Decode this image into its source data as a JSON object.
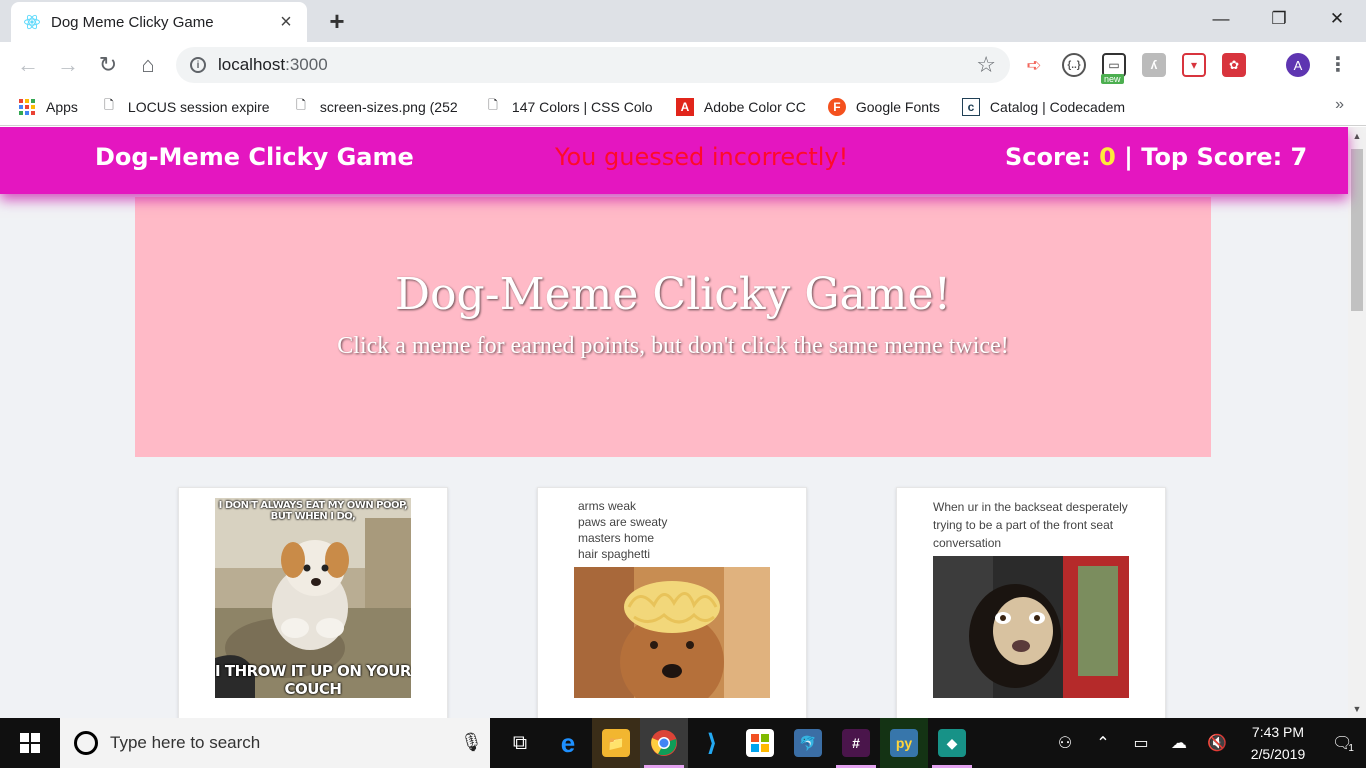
{
  "browser": {
    "tab_title": "Dog Meme Clicky Game",
    "url_host": "localhost",
    "url_port": ":3000",
    "ext_badge": "new",
    "profile_initial": "A",
    "bookmarks": [
      {
        "label": "Apps",
        "icon": "apps-grid-icon"
      },
      {
        "label": "LOCUS session expire",
        "icon": "page-icon"
      },
      {
        "label": "screen-sizes.png (252",
        "icon": "page-icon"
      },
      {
        "label": "147 Colors | CSS Colo",
        "icon": "page-icon"
      },
      {
        "label": "Adobe Color CC",
        "icon": "adobe-icon"
      },
      {
        "label": "Google Fonts",
        "icon": "google-fonts-icon"
      },
      {
        "label": "Catalog | Codecadem",
        "icon": "codecademy-icon"
      }
    ]
  },
  "app": {
    "brand": "Dog-Meme Clicky Game",
    "message": "You guessed incorrectly!",
    "score_label": "Score: ",
    "score_value": "0",
    "top_score_text": " | Top Score: 7",
    "jumbotron_title": "Dog-Meme Clicky Game!",
    "jumbotron_subtitle": "Click a meme for earned points, but don't click the same meme twice!",
    "cards": [
      {
        "caption_top": "I DON'T ALWAYS EAT MY OWN POOP, BUT WHEN I DO,",
        "caption_bottom": "I THROW IT UP ON YOUR COUCH"
      },
      {
        "text_lines": [
          "arms weak",
          "paws are sweaty",
          "masters home",
          "hair spaghetti"
        ]
      },
      {
        "text_lines": [
          "When ur in the backseat desperately",
          "trying to be a part of the front seat",
          "conversation"
        ]
      }
    ]
  },
  "taskbar": {
    "search_placeholder": "Type here to search",
    "time": "7:43 PM",
    "date": "2/5/2019",
    "notification_count": "1"
  },
  "colors": {
    "nav_bg": "#e416c0",
    "jumbotron_bg": "#ffbac7",
    "message_red": "#ff0a2a",
    "score_yellow": "#ffeb3b"
  }
}
